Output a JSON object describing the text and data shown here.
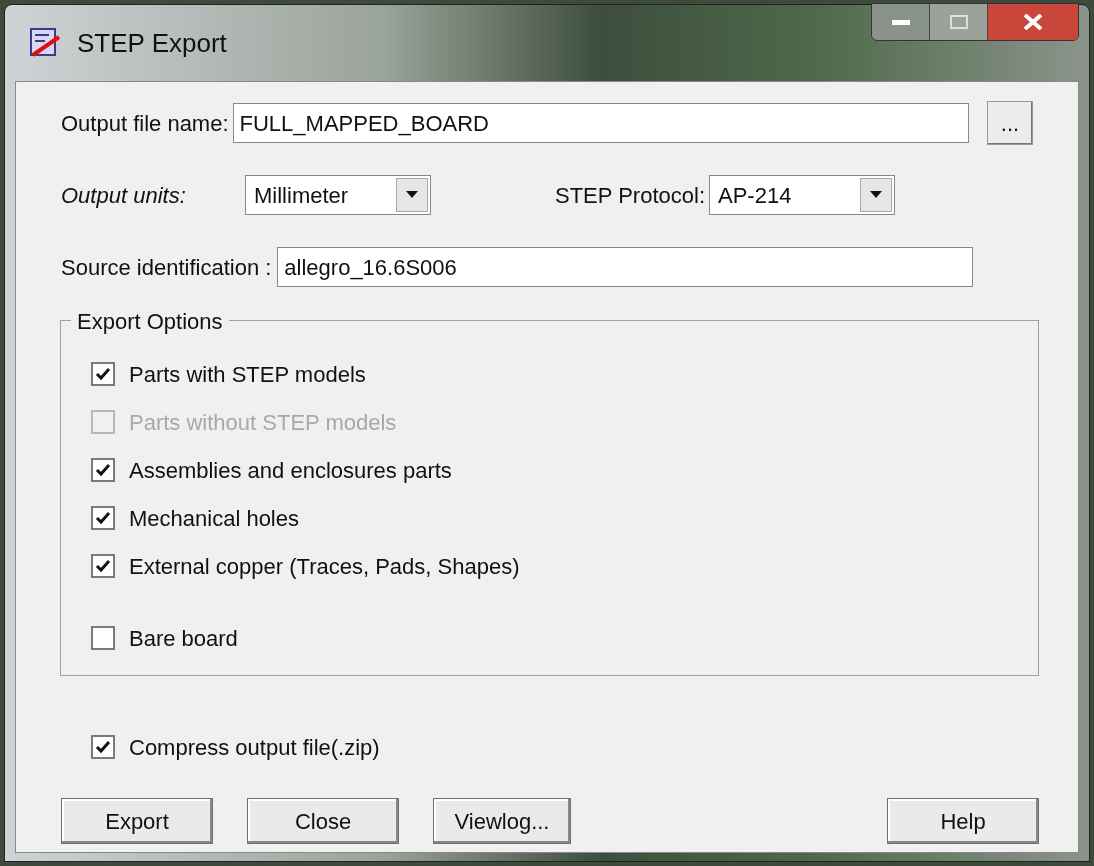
{
  "window": {
    "title": "STEP Export"
  },
  "output_file": {
    "label": "Output file name:",
    "value": "FULL_MAPPED_BOARD",
    "browse": "..."
  },
  "output_units": {
    "label": "Output units:",
    "value": "Millimeter"
  },
  "step_protocol": {
    "label": "STEP Protocol:",
    "value": "AP-214"
  },
  "source_identification": {
    "label": "Source identification :",
    "value": "allegro_16.6S006"
  },
  "export_options": {
    "title": "Export Options",
    "options": [
      {
        "label": "Parts with STEP models",
        "checked": true,
        "disabled": false
      },
      {
        "label": "Parts without STEP models",
        "checked": false,
        "disabled": true
      },
      {
        "label": "Assemblies and enclosures parts",
        "checked": true,
        "disabled": false
      },
      {
        "label": "Mechanical holes",
        "checked": true,
        "disabled": false
      },
      {
        "label": "External copper (Traces, Pads, Shapes)",
        "checked": true,
        "disabled": false
      },
      {
        "label": "Bare board",
        "checked": false,
        "disabled": false
      }
    ]
  },
  "compress": {
    "label": "Compress output file(.zip)",
    "checked": true,
    "disabled": false
  },
  "buttons": [
    {
      "label": "Export",
      "kind": "left"
    },
    {
      "label": "Close",
      "kind": "left"
    },
    {
      "label": "Viewlog...",
      "kind": "left"
    },
    {
      "label": "Help",
      "kind": "right"
    }
  ]
}
